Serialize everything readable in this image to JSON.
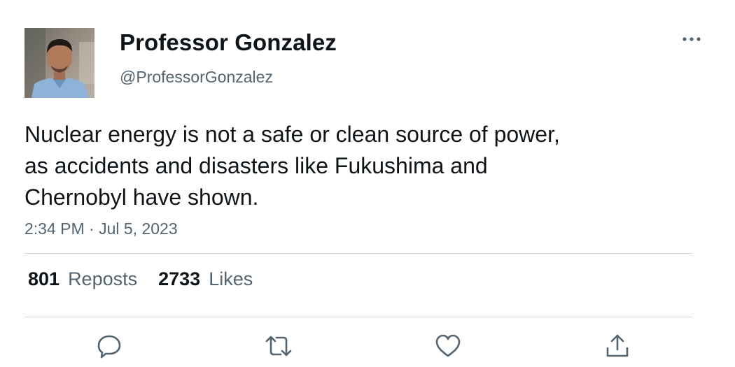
{
  "author": {
    "display_name": "Professor Gonzalez",
    "handle": "@ProfessorGonzalez"
  },
  "tweet": {
    "text_lines": [
      "Nuclear energy is not a safe or clean source of power,",
      "as accidents and disasters like Fukushima and",
      "Chernobyl have shown."
    ],
    "timestamp": "2:34 PM · Jul 5, 2023"
  },
  "stats": {
    "reposts_count": "801",
    "reposts_label": "Reposts",
    "likes_count": "2733",
    "likes_label": "Likes"
  },
  "actions": {
    "reply_icon": "speech-bubble-icon",
    "repost_icon": "repost-arrows-icon",
    "like_icon": "heart-icon",
    "share_icon": "share-upload-icon"
  },
  "colors": {
    "text_primary": "#0f1419",
    "text_secondary": "#536471",
    "divider": "#cfd9de",
    "icon": "#536471"
  }
}
